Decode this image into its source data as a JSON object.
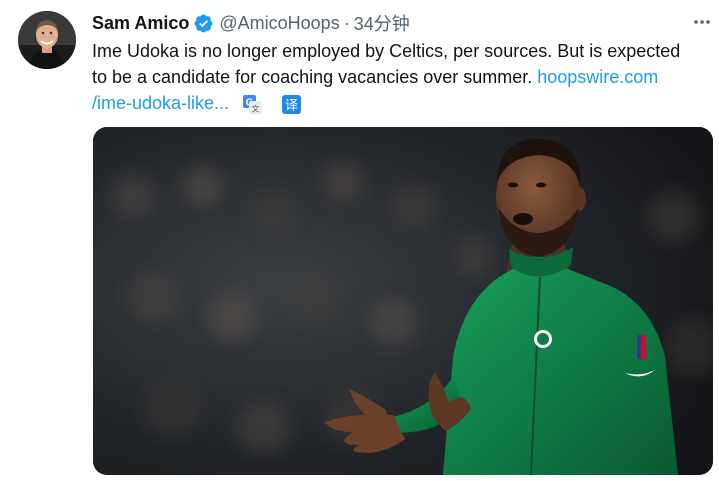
{
  "tweet": {
    "author": {
      "display_name": "Sam Amico",
      "handle": "@AmicoHoops",
      "verified": true
    },
    "separator": "·",
    "time": "34分钟",
    "text": {
      "line1": "Ime Udoka is no longer employed by Celtics, per sources. But is expected",
      "line2_text": "to be a candidate for coaching vacancies over summer. ",
      "line2_link": "hoopswire.com",
      "line3_link": "/ime-udoka-like..."
    },
    "icons": {
      "verified": "verified-badge-icon",
      "more": "more-options-icon",
      "google_translate": "google-translate-icon",
      "translate": "translate-icon"
    },
    "translate_glyph": "译",
    "colors": {
      "text": "#0f1419",
      "secondary": "#536471",
      "link": "#1d9bf0",
      "verified": "#1d9bf0",
      "jersey": "#0f7a44"
    }
  }
}
